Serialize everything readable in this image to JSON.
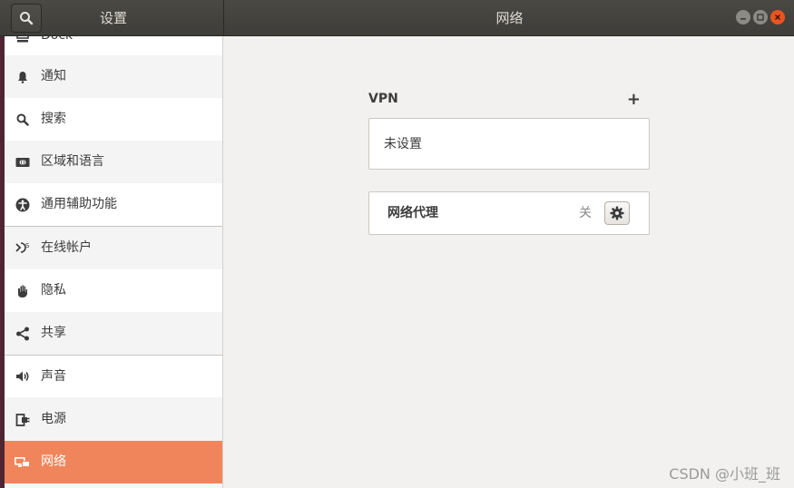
{
  "window": {
    "sidebar_title": "设置",
    "main_title": "网络"
  },
  "sidebar": {
    "items": [
      {
        "label": "Dock",
        "icon": "dock-icon"
      },
      {
        "label": "通知",
        "icon": "bell-icon"
      },
      {
        "label": "搜索",
        "icon": "search-icon"
      },
      {
        "label": "区域和语言",
        "icon": "region-icon"
      },
      {
        "label": "通用辅助功能",
        "icon": "accessibility-icon"
      },
      {
        "label": "在线帐户",
        "icon": "online-accounts-icon"
      },
      {
        "label": "隐私",
        "icon": "privacy-hand-icon"
      },
      {
        "label": "共享",
        "icon": "share-icon"
      },
      {
        "label": "声音",
        "icon": "speaker-icon"
      },
      {
        "label": "电源",
        "icon": "power-icon"
      },
      {
        "label": "网络",
        "icon": "network-icon",
        "active": true
      }
    ]
  },
  "vpn": {
    "title": "VPN",
    "add_label": "+",
    "empty_text": "未设置"
  },
  "proxy": {
    "label": "网络代理",
    "status": "关"
  },
  "watermark": "CSDN @小班_班",
  "colors": {
    "accent": "#f0855b",
    "close_button": "#e95420",
    "headerbar": "#3e3d39"
  }
}
